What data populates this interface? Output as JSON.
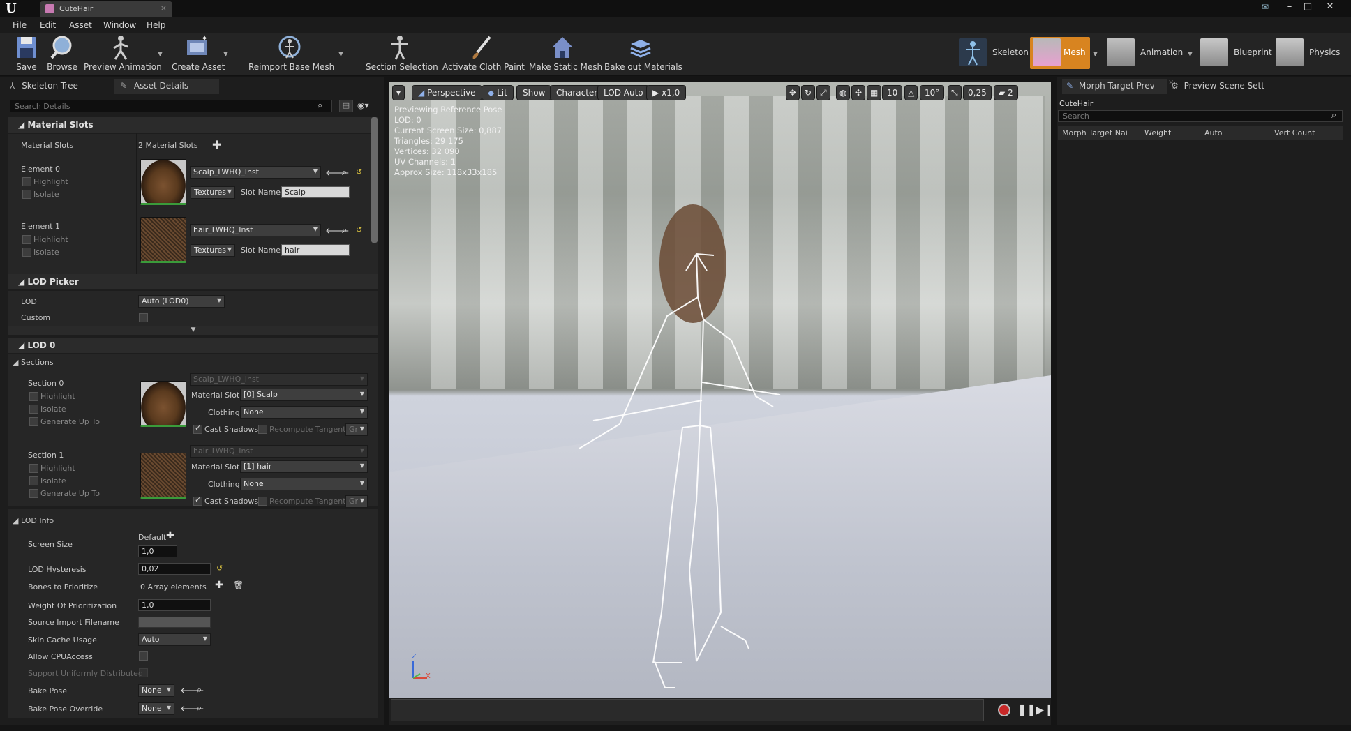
{
  "window": {
    "tab_title": "CuteHair",
    "minimize": "–",
    "maximize": "□",
    "close": "✕"
  },
  "menu": [
    "File",
    "Edit",
    "Asset",
    "Window",
    "Help"
  ],
  "toolbar": {
    "save": "Save",
    "browse": "Browse",
    "preview_animation": "Preview Animation",
    "create_asset": "Create Asset",
    "reimport": "Reimport Base Mesh",
    "section_selection": "Section Selection",
    "activate_cloth_paint": "Activate Cloth Paint",
    "make_static_mesh": "Make Static Mesh",
    "bake_out_materials": "Bake out Materials"
  },
  "modes": {
    "skeleton": "Skeleton",
    "mesh": "Mesh",
    "animation": "Animation",
    "blueprint": "Blueprint",
    "physics": "Physics"
  },
  "left_tabs": {
    "skeleton_tree": "Skeleton Tree",
    "asset_details": "Asset Details"
  },
  "search_placeholder": "Search Details",
  "material_slots": {
    "header": "Material Slots",
    "label": "Material Slots",
    "count": "2 Material Slots",
    "elements": [
      {
        "name": "Element 0",
        "material": "Scalp_LWHQ_Inst",
        "textures": "Textures",
        "slot_name_label": "Slot Name",
        "slot_name": "Scalp"
      },
      {
        "name": "Element 1",
        "material": "hair_LWHQ_Inst",
        "textures": "Textures",
        "slot_name_label": "Slot Name",
        "slot_name": "hair"
      }
    ],
    "highlight": "Highlight",
    "isolate": "Isolate"
  },
  "lod_picker": {
    "header": "LOD Picker",
    "lod_label": "LOD",
    "lod_value": "Auto (LOD0)",
    "custom_label": "Custom"
  },
  "lod0": {
    "header": "LOD 0",
    "sections_header": "Sections",
    "sections": [
      {
        "name": "Section 0",
        "material": "Scalp_LWHQ_Inst",
        "material_slot": "[0] Scalp",
        "clothing": "None"
      },
      {
        "name": "Section 1",
        "material": "hair_LWHQ_Inst",
        "material_slot": "[1] hair",
        "clothing": "None"
      }
    ],
    "highlight": "Highlight",
    "isolate": "Isolate",
    "generate_up_to": "Generate Up To",
    "material_slot_label": "Material Slot",
    "clothing_label": "Clothing",
    "cast_shadows": "Cast Shadows",
    "recompute_tangent": "Recompute Tangent",
    "gr": "Gr"
  },
  "lod_info": {
    "header": "LOD Info",
    "screen_size": "Screen Size",
    "default": "Default",
    "screen_size_value": "1,0",
    "lod_hysteresis": "LOD Hysteresis",
    "lod_hysteresis_value": "0,02",
    "bones_to_prioritize": "Bones to Prioritize",
    "bones_value": "0 Array elements",
    "weight_prioritization": "Weight Of Prioritization",
    "weight_value": "1,0",
    "source_import": "Source Import Filename",
    "skin_cache": "Skin Cache Usage",
    "skin_cache_value": "Auto",
    "allow_cpu": "Allow CPUAccess",
    "support_uniform": "Support Uniformly Distributed",
    "bake_pose": "Bake Pose",
    "bake_pose_value": "None",
    "bake_pose_override": "Bake Pose Override",
    "bake_pose_override_value": "None"
  },
  "viewport": {
    "perspective": "Perspective",
    "lit": "Lit",
    "show": "Show",
    "character": "Character",
    "lod_auto": "LOD Auto",
    "speed": "x1,0",
    "grid": "10",
    "angle": "10°",
    "scale": "0,25",
    "cam_speed": "2",
    "info": [
      "Previewing Reference Pose",
      "LOD: 0",
      "Current Screen Size: 0,887",
      "Triangles: 29 175",
      "Vertices: 32 090",
      "UV Channels: 1",
      "Approx Size: 118x33x185"
    ],
    "axis_z": "Z",
    "axis_x": "X"
  },
  "right_panel": {
    "tab_morph": "Morph Target Prev",
    "tab_preview": "Preview Scene Sett",
    "asset": "CuteHair",
    "search": "Search",
    "columns": [
      "Morph Target Nai",
      "Weight",
      "Auto",
      "Vert Count"
    ]
  },
  "colors": {
    "mesh_mode_bg": "#d88420",
    "accent_green": "#3a9b3a"
  }
}
